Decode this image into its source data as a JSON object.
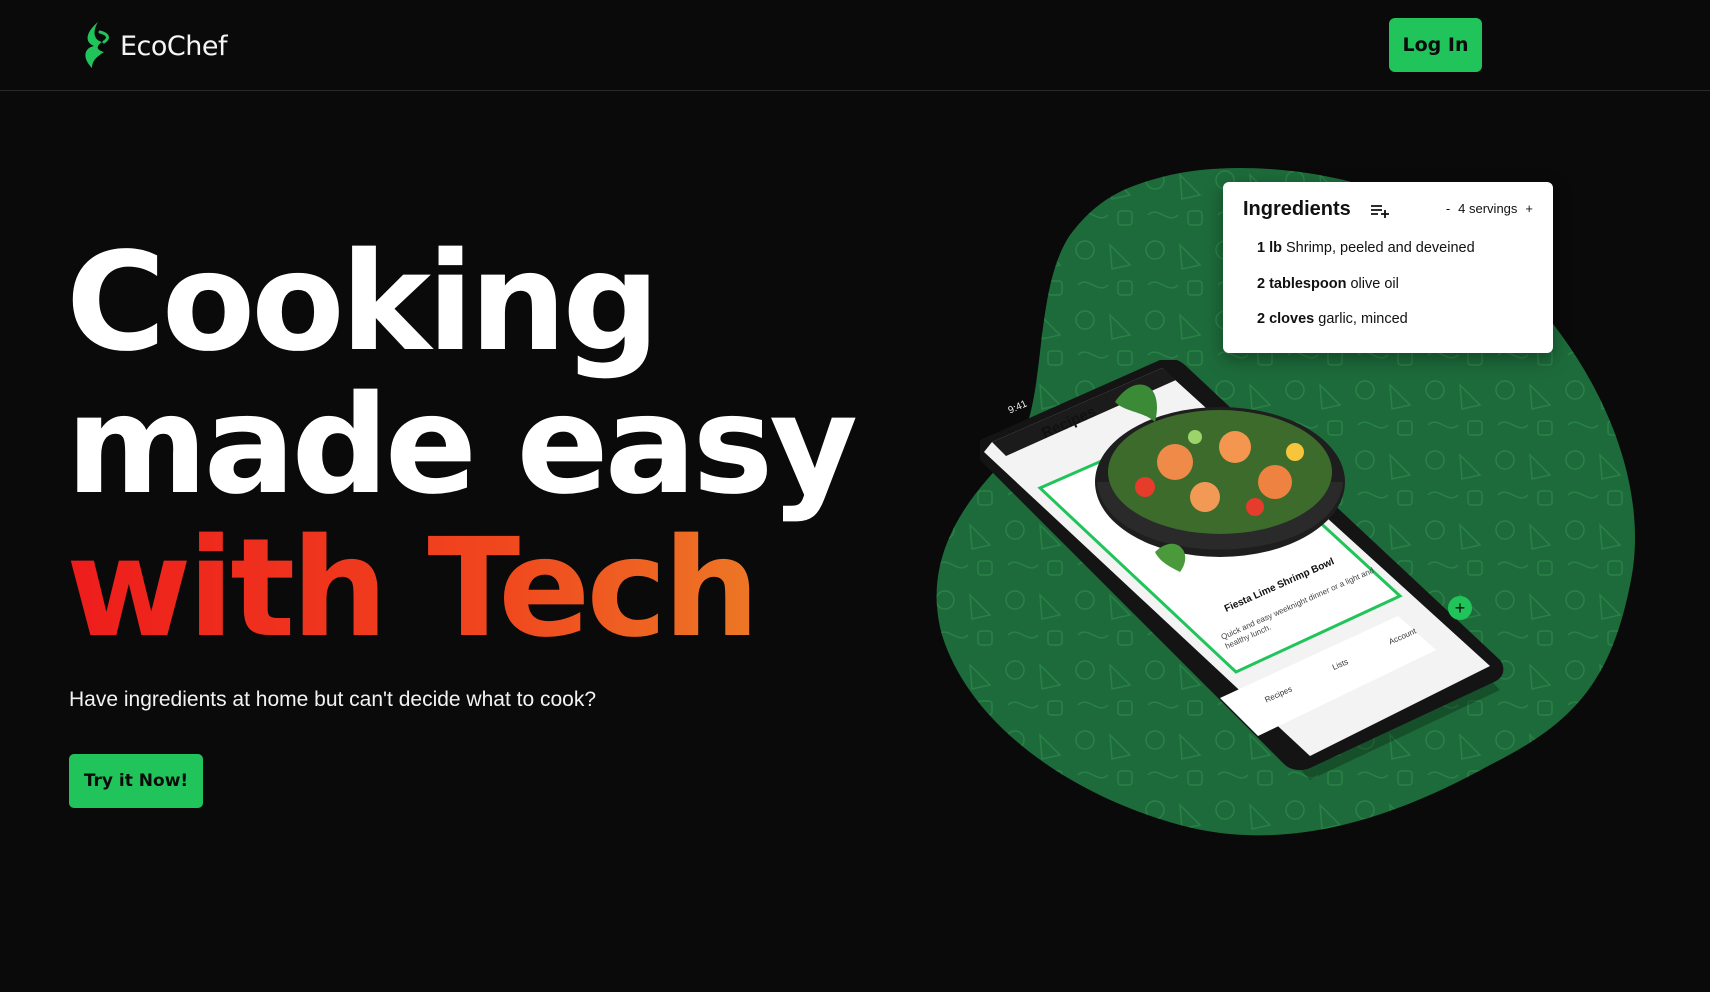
{
  "header": {
    "brand": "EcoChef",
    "login_label": "Log In"
  },
  "hero": {
    "title_line1": "Cooking",
    "title_line2": "made easy",
    "title_line3": "with Tech",
    "subtitle": "Have ingredients at home but can't decide what to cook?",
    "cta_label": "Try it Now!"
  },
  "ingredients": {
    "title": "Ingredients",
    "servings_minus": "-",
    "servings_label": "4 servings",
    "servings_plus": "+",
    "items": [
      {
        "qty": "1 lb",
        "name": "Shrimp, peeled and deveined"
      },
      {
        "qty": "2 tablespoon",
        "name": "olive oil"
      },
      {
        "qty": "2 cloves",
        "name": "garlic, minced"
      }
    ]
  },
  "phone": {
    "status_time": "9:41",
    "screen_title": "Recipes",
    "recipe_name": "Fiesta Lime Shrimp Bowl",
    "recipe_desc": "Quick and easy weeknight dinner or a light and healthy lunch.",
    "tabs": [
      "Recipes",
      "Lists",
      "Account"
    ],
    "fab": "+"
  },
  "colors": {
    "background": "#0a0a0b",
    "accent_green": "#21c45a",
    "blob_green": "#1d6b3a",
    "gradient_start": "#ee1c1c",
    "gradient_end": "#ec8a28"
  },
  "icons": [
    "leaf-logo-icon",
    "playlist-add-icon",
    "book-icon",
    "list-icon",
    "avatar-icon",
    "plus-icon"
  ]
}
